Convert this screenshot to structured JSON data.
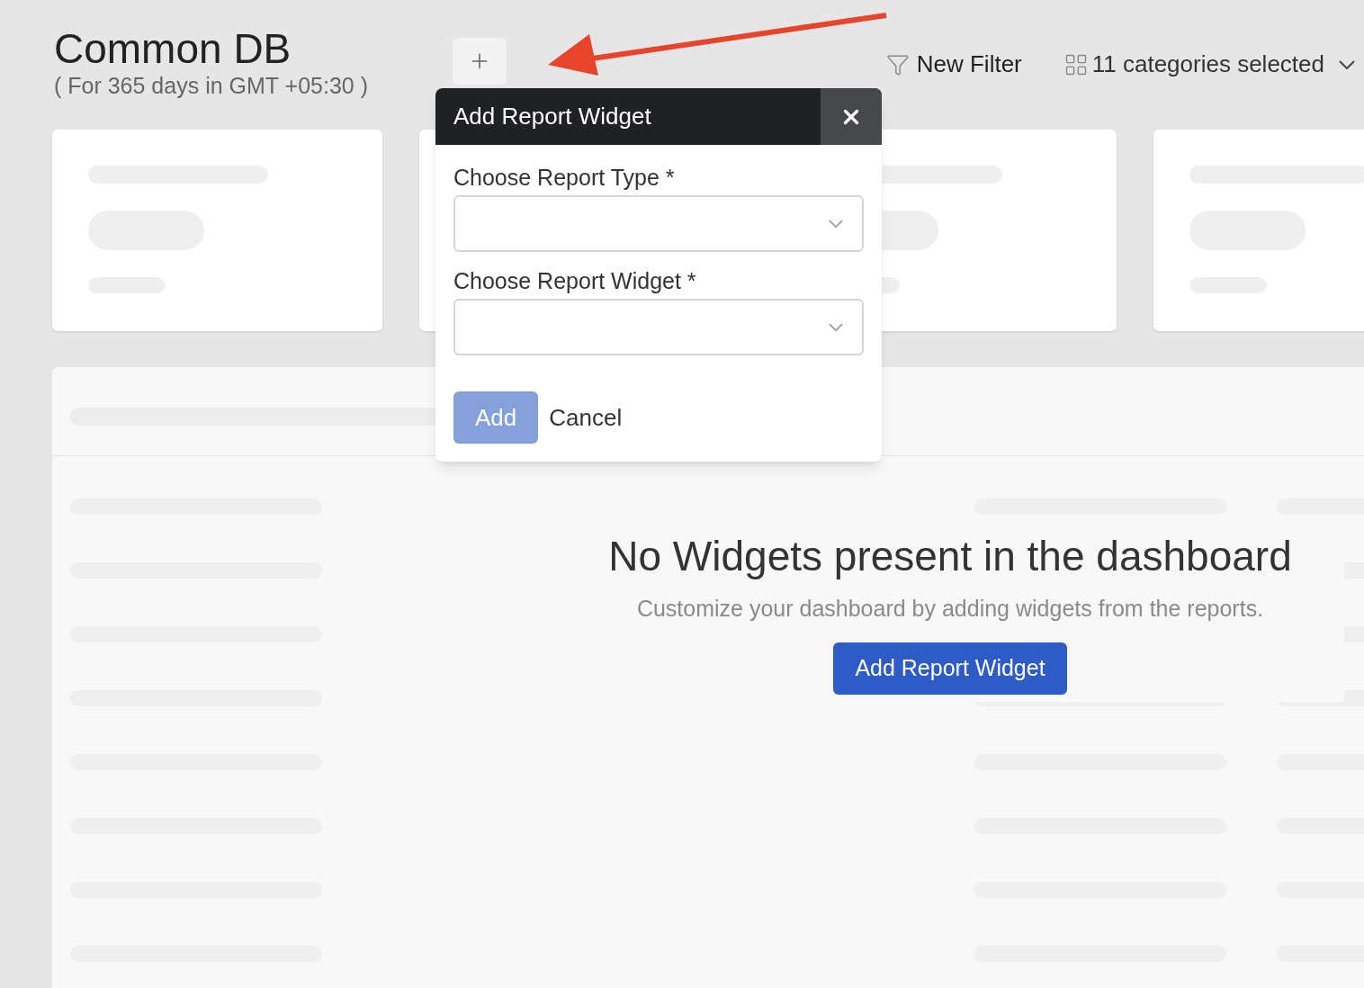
{
  "header": {
    "title": "Common DB",
    "subtitle": "( For 365 days in GMT +05:30 )"
  },
  "toolbar": {
    "filter_label": "New Filter",
    "categories_label": "11 categories selected"
  },
  "dialog": {
    "title": "Add Report Widget",
    "fields": [
      {
        "label": "Choose Report Type *"
      },
      {
        "label": "Choose Report Widget *"
      }
    ],
    "buttons": [
      {
        "label": "Add",
        "kind": "primary",
        "disabled": true
      },
      {
        "label": "Cancel",
        "kind": "link",
        "disabled": false
      }
    ]
  },
  "empty_state": {
    "title": "No Widgets present in the dashboard",
    "message": "Customize your dashboard by adding widgets from the reports.",
    "button": "Add Report Widget"
  }
}
